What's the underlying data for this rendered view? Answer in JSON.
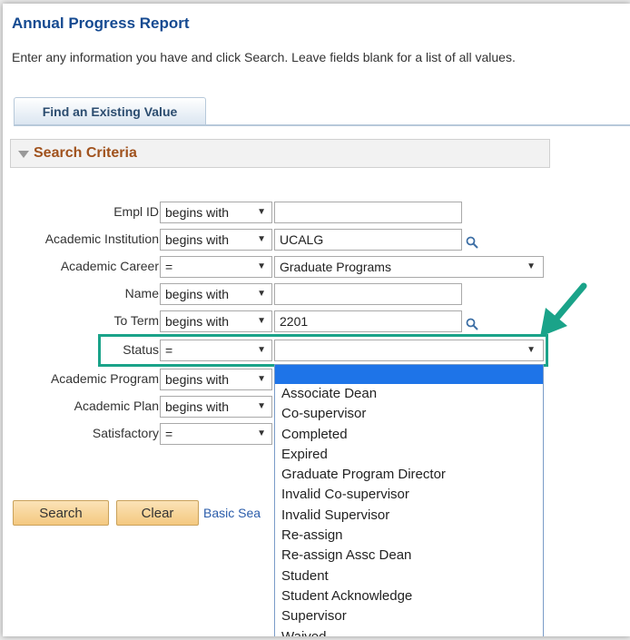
{
  "page": {
    "title": "Annual Progress Report",
    "instructions": "Enter any information you have and click Search. Leave fields blank for a list of all values."
  },
  "tabs": [
    {
      "label": "Find an Existing Value"
    }
  ],
  "section": {
    "title": "Search Criteria"
  },
  "criteria": [
    {
      "label": "Empl ID",
      "operator": "begins with",
      "value": ""
    },
    {
      "label": "Academic Institution",
      "operator": "begins with",
      "value": "UCALG"
    },
    {
      "label": "Academic Career",
      "operator": "=",
      "value": "Graduate Programs"
    },
    {
      "label": "Name",
      "operator": "begins with",
      "value": ""
    },
    {
      "label": "To Term",
      "operator": "begins with",
      "value": "2201"
    },
    {
      "label": "Status",
      "operator": "=",
      "value": ""
    },
    {
      "label": "Academic Program",
      "operator": "begins with",
      "value": ""
    },
    {
      "label": "Academic Plan",
      "operator": "begins with",
      "value": ""
    },
    {
      "label": "Satisfactory",
      "operator": "=",
      "value": ""
    }
  ],
  "status_options": [
    "Associate Dean",
    "Co-supervisor",
    "Completed",
    "Expired",
    "Graduate Program Director",
    "Invalid Co-supervisor",
    "Invalid Supervisor",
    "Re-assign",
    "Re-assign Assc Dean",
    "Student",
    "Student Acknowledge",
    "Supervisor",
    "Waived"
  ],
  "buttons": {
    "search": "Search",
    "clear": "Clear",
    "basic_search": "Basic Sea"
  },
  "colors": {
    "highlight": "#1aa389",
    "title": "#154a91",
    "section_title": "#a0521d",
    "selected_option": "#1e74e8"
  },
  "icons": {
    "lookup": "magnifier-icon",
    "caret": "chevron-down-icon",
    "annotation": "arrow-icon"
  }
}
